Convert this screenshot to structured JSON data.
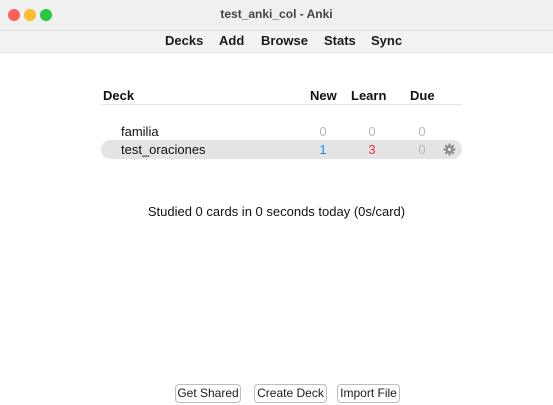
{
  "window": {
    "title": "test_anki_col - Anki",
    "controls": {
      "close_color": "#fe5f57",
      "minimize_color": "#febc2e",
      "maximize_color": "#28c840"
    }
  },
  "toolbar": {
    "items": [
      {
        "label": "Decks"
      },
      {
        "label": "Add"
      },
      {
        "label": "Browse"
      },
      {
        "label": "Stats"
      },
      {
        "label": "Sync"
      }
    ]
  },
  "deck_table": {
    "headers": {
      "deck": "Deck",
      "new": "New",
      "learn": "Learn",
      "due": "Due"
    },
    "rows": [
      {
        "name": "familia",
        "new": "0",
        "learn": "0",
        "due": "0",
        "selected": false
      },
      {
        "name": "test_oraciones",
        "new": "1",
        "learn": "3",
        "due": "0",
        "selected": true,
        "options_icon": "gear-icon"
      }
    ],
    "colors": {
      "zero": "#b8b8b8",
      "new": "#1e88e5",
      "learn": "#e53935",
      "gear": "#8c8c8c"
    }
  },
  "summary": "Studied 0 cards in 0 seconds today (0s/card)",
  "bottom_buttons": {
    "get_shared": "Get Shared",
    "create_deck": "Create Deck",
    "import_file": "Import File"
  }
}
